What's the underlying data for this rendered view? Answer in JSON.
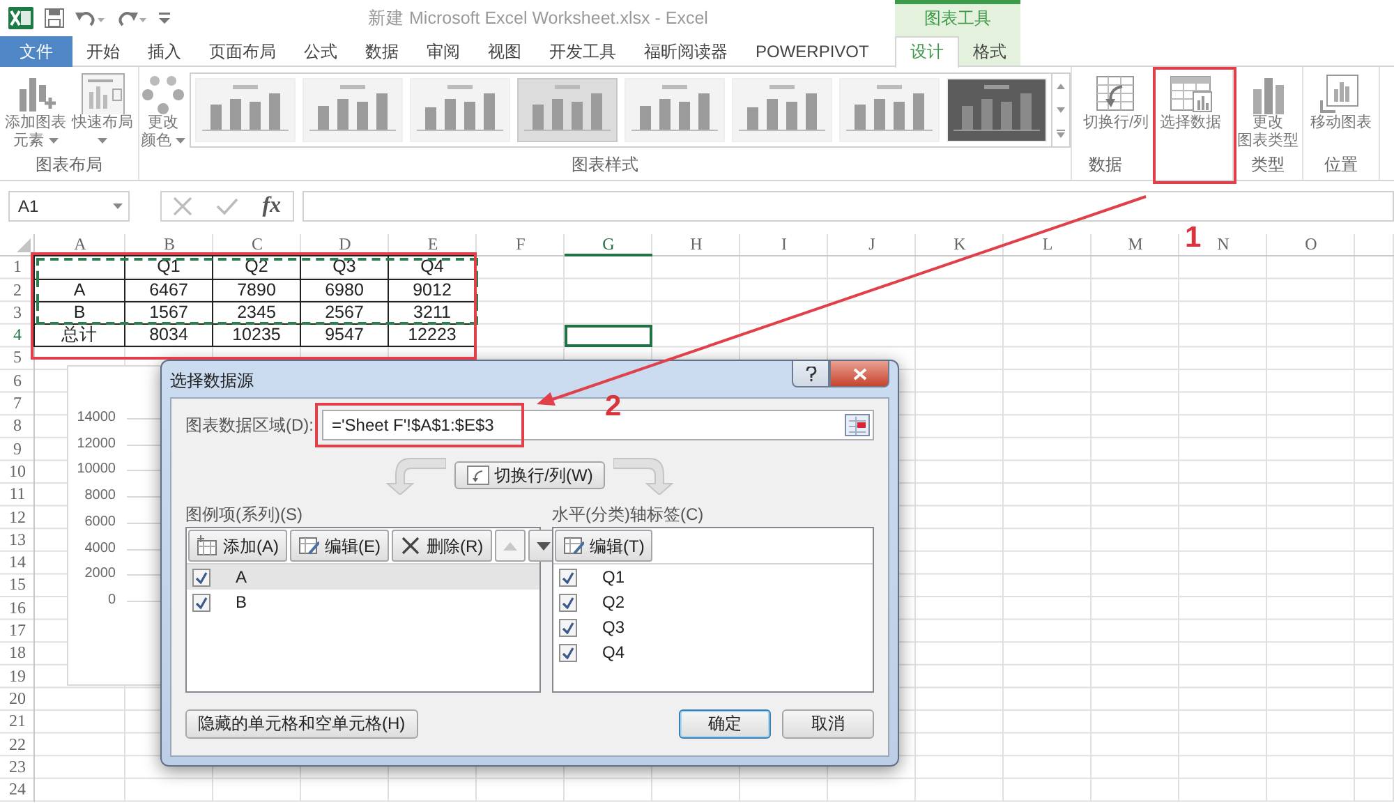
{
  "title_bar": {
    "title": "新建 Microsoft Excel Worksheet.xlsx - Excel",
    "context_group": "图表工具"
  },
  "ribbon_tabs": [
    {
      "label": "文件",
      "kind": "file",
      "selected": false
    },
    {
      "label": "开始",
      "kind": "normal",
      "selected": false
    },
    {
      "label": "插入",
      "kind": "normal",
      "selected": false
    },
    {
      "label": "页面布局",
      "kind": "normal",
      "selected": false
    },
    {
      "label": "公式",
      "kind": "normal",
      "selected": false
    },
    {
      "label": "数据",
      "kind": "normal",
      "selected": false
    },
    {
      "label": "审阅",
      "kind": "normal",
      "selected": false
    },
    {
      "label": "视图",
      "kind": "normal",
      "selected": false
    },
    {
      "label": "开发工具",
      "kind": "normal",
      "selected": false
    },
    {
      "label": "福昕阅读器",
      "kind": "normal",
      "selected": false
    },
    {
      "label": "POWERPIVOT",
      "kind": "normal",
      "selected": false
    },
    {
      "label": "设计",
      "kind": "context",
      "selected": true
    },
    {
      "label": "格式",
      "kind": "context",
      "selected": false
    }
  ],
  "ribbon_groups": [
    {
      "label": "图表布局",
      "items": [
        {
          "kind": "add_element",
          "lines": [
            "添加图表",
            "元素"
          ],
          "dropdown": true
        },
        {
          "kind": "quick_layout",
          "lines": [
            "快速布局"
          ],
          "dropdown": true
        }
      ]
    },
    {
      "label": "图表样式",
      "items": [
        {
          "kind": "colors",
          "lines": [
            "更改",
            "颜色"
          ],
          "dropdown": true
        },
        {
          "kind": "gallery",
          "styles": [
            {
              "kind": "light",
              "selected": false
            },
            {
              "kind": "light",
              "selected": false
            },
            {
              "kind": "light",
              "selected": false
            },
            {
              "kind": "light",
              "selected": true
            },
            {
              "kind": "light",
              "selected": false
            },
            {
              "kind": "light",
              "selected": false
            },
            {
              "kind": "light",
              "selected": false
            },
            {
              "kind": "dark",
              "selected": false
            }
          ]
        }
      ]
    },
    {
      "label": "数据",
      "items": [
        {
          "kind": "switch",
          "lines": [
            "切换行/列"
          ],
          "dropdown": false
        },
        {
          "kind": "select_data",
          "lines": [
            "选择数据"
          ],
          "dropdown": false
        }
      ]
    },
    {
      "label": "类型",
      "items": [
        {
          "kind": "chart_type",
          "lines": [
            "更改",
            "图表类型"
          ],
          "dropdown": false
        }
      ]
    },
    {
      "label": "位置",
      "items": [
        {
          "kind": "move_chart",
          "lines": [
            "移动图表"
          ],
          "dropdown": false
        }
      ]
    }
  ],
  "formula_bar": {
    "name_box": "A1",
    "function_button": "fx"
  },
  "sheet": {
    "columns": [
      {
        "label": "A",
        "selected": false
      },
      {
        "label": "B",
        "selected": false
      },
      {
        "label": "C",
        "selected": false
      },
      {
        "label": "D",
        "selected": false
      },
      {
        "label": "E",
        "selected": false
      },
      {
        "label": "F",
        "selected": false
      },
      {
        "label": "G",
        "selected": true
      },
      {
        "label": "H",
        "selected": false
      },
      {
        "label": "I",
        "selected": false
      },
      {
        "label": "J",
        "selected": false
      },
      {
        "label": "K",
        "selected": false
      },
      {
        "label": "L",
        "selected": false
      },
      {
        "label": "M",
        "selected": false
      },
      {
        "label": "N",
        "selected": false
      },
      {
        "label": "O",
        "selected": false
      }
    ],
    "rows": [
      {
        "number": "1",
        "selected": false,
        "in_copy_range": true,
        "cells": [
          "",
          "Q1",
          "Q2",
          "Q3",
          "Q4"
        ]
      },
      {
        "number": "2",
        "selected": false,
        "in_copy_range": true,
        "cells": [
          "A",
          "6467",
          "7890",
          "6980",
          "9012"
        ]
      },
      {
        "number": "3",
        "selected": false,
        "in_copy_range": true,
        "cells": [
          "B",
          "1567",
          "2345",
          "2567",
          "3211"
        ]
      },
      {
        "number": "4",
        "selected": true,
        "in_copy_range": false,
        "cells": [
          "总计",
          "8034",
          "10235",
          "9547",
          "12223"
        ]
      },
      {
        "number": "5",
        "selected": false,
        "in_copy_range": false
      },
      {
        "number": "6",
        "selected": false,
        "in_copy_range": false
      },
      {
        "number": "7",
        "selected": false,
        "in_copy_range": false
      },
      {
        "number": "8",
        "selected": false,
        "in_copy_range": false
      },
      {
        "number": "9",
        "selected": false,
        "in_copy_range": false
      },
      {
        "number": "10",
        "selected": false,
        "in_copy_range": false
      },
      {
        "number": "11",
        "selected": false,
        "in_copy_range": false
      },
      {
        "number": "12",
        "selected": false,
        "in_copy_range": false
      },
      {
        "number": "13",
        "selected": false,
        "in_copy_range": false
      },
      {
        "number": "14",
        "selected": false,
        "in_copy_range": false
      },
      {
        "number": "15",
        "selected": false,
        "in_copy_range": false
      },
      {
        "number": "16",
        "selected": false,
        "in_copy_range": false
      },
      {
        "number": "17",
        "selected": false,
        "in_copy_range": false
      },
      {
        "number": "18",
        "selected": false,
        "in_copy_range": false
      },
      {
        "number": "19",
        "selected": false,
        "in_copy_range": false
      },
      {
        "number": "20",
        "selected": false,
        "in_copy_range": false
      },
      {
        "number": "21",
        "selected": false,
        "in_copy_range": false
      },
      {
        "number": "22",
        "selected": false,
        "in_copy_range": false
      },
      {
        "number": "23",
        "selected": false,
        "in_copy_range": false
      },
      {
        "number": "24",
        "selected": false,
        "in_copy_range": false
      }
    ]
  },
  "chart": {
    "axis_labels": [
      "14000",
      "12000",
      "10000",
      "8000",
      "6000",
      "4000",
      "2000",
      "0"
    ]
  },
  "dialog": {
    "title": "选择数据源",
    "range_label": "图表数据区域(D):",
    "range_value": "='Sheet F'!$A$1:$E$3",
    "switch_button": "切换行/列(W)",
    "series_label": "图例项(系列)(S)",
    "series_buttons": [
      {
        "kind": "add",
        "label": "添加(A)"
      },
      {
        "kind": "edit",
        "label": "编辑(E)"
      },
      {
        "kind": "delete",
        "label": "删除(R)"
      }
    ],
    "move_buttons": [
      {
        "kind": "up",
        "disabled": true
      },
      {
        "kind": "down",
        "disabled": false
      }
    ],
    "series": [
      {
        "name": "A",
        "checked": true,
        "selected": true
      },
      {
        "name": "B",
        "checked": true,
        "selected": false
      }
    ],
    "axis_label": "水平(分类)轴标签(C)",
    "axis_edit_button": "编辑(T)",
    "categories": [
      {
        "name": "Q1",
        "checked": true
      },
      {
        "name": "Q2",
        "checked": true
      },
      {
        "name": "Q3",
        "checked": true
      },
      {
        "name": "Q4",
        "checked": true
      }
    ],
    "hidden_cells_button": "隐藏的单元格和空单元格(H)",
    "ok_button": "确定",
    "cancel_button": "取消"
  },
  "annotations": [
    {
      "label": "1"
    },
    {
      "label": "2"
    }
  ]
}
